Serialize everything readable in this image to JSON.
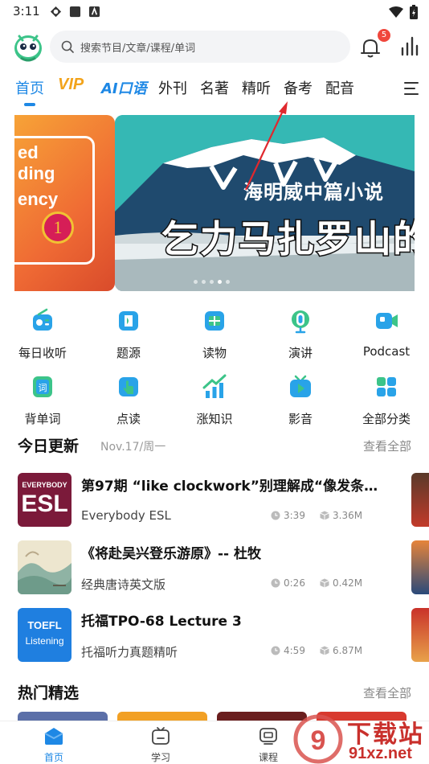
{
  "status_bar": {
    "time": "3:11"
  },
  "search": {
    "placeholder": "搜索节目/文章/课程/单词"
  },
  "notifications": {
    "count": "5"
  },
  "tabs": [
    {
      "label": "首页",
      "active": true
    },
    {
      "label": "VIP"
    },
    {
      "label": "AI口语"
    },
    {
      "label": "外刊"
    },
    {
      "label": "名著"
    },
    {
      "label": "精听"
    },
    {
      "label": "备考"
    },
    {
      "label": "配音"
    }
  ],
  "banner": {
    "left_slide_text": [
      "ed",
      "ding",
      "ency"
    ],
    "left_slide_number": "1",
    "subtitle": "海明威中篇小说",
    "title": "乞力马扎罗山的",
    "active_dot": 3
  },
  "grid": [
    {
      "label": "每日收听",
      "icon": "radio-icon"
    },
    {
      "label": "题源",
      "icon": "book-icon"
    },
    {
      "label": "读物",
      "icon": "reader-icon"
    },
    {
      "label": "演讲",
      "icon": "microphone-icon"
    },
    {
      "label": "Podcast",
      "icon": "video-camera-icon"
    },
    {
      "label": "背单词",
      "icon": "vocabulary-icon"
    },
    {
      "label": "点读",
      "icon": "tap-read-icon"
    },
    {
      "label": "涨知识",
      "icon": "growth-chart-icon"
    },
    {
      "label": "影音",
      "icon": "tv-play-icon"
    },
    {
      "label": "全部分类",
      "icon": "all-categories-icon"
    }
  ],
  "today": {
    "title": "今日更新",
    "date": "Nov.17/周一",
    "more": "查看全部",
    "items": [
      {
        "title": "第97期 “like clockwork”别理解成“像发条装…",
        "source": "Everybody ESL",
        "duration": "3:39",
        "size": "3.36M",
        "thumb_text_1": "EVERYBODY",
        "thumb_text_2": "ESL"
      },
      {
        "title": "《将赴吴兴登乐游原》-- 杜牧",
        "source": "经典唐诗英文版",
        "duration": "0:26",
        "size": "0.42M"
      },
      {
        "title": "托福TPO-68 Lecture 3",
        "source": "托福听力真题精听",
        "duration": "4:59",
        "size": "6.87M",
        "thumb_text_1": "TOEFL",
        "thumb_text_2": "Listening"
      }
    ]
  },
  "hot": {
    "title": "热门精选",
    "more": "查看全部"
  },
  "bottom_nav": [
    {
      "label": "首页",
      "active": true
    },
    {
      "label": "学习"
    },
    {
      "label": "课程"
    }
  ],
  "watermark": {
    "text1": "下载站",
    "text2": "91xz.net"
  },
  "colors": {
    "accent": "#1e88e5",
    "vip": "#f2a31b",
    "icon_green": "#3cc489",
    "icon_blue": "#29a3e8",
    "badge": "#f0473c"
  }
}
